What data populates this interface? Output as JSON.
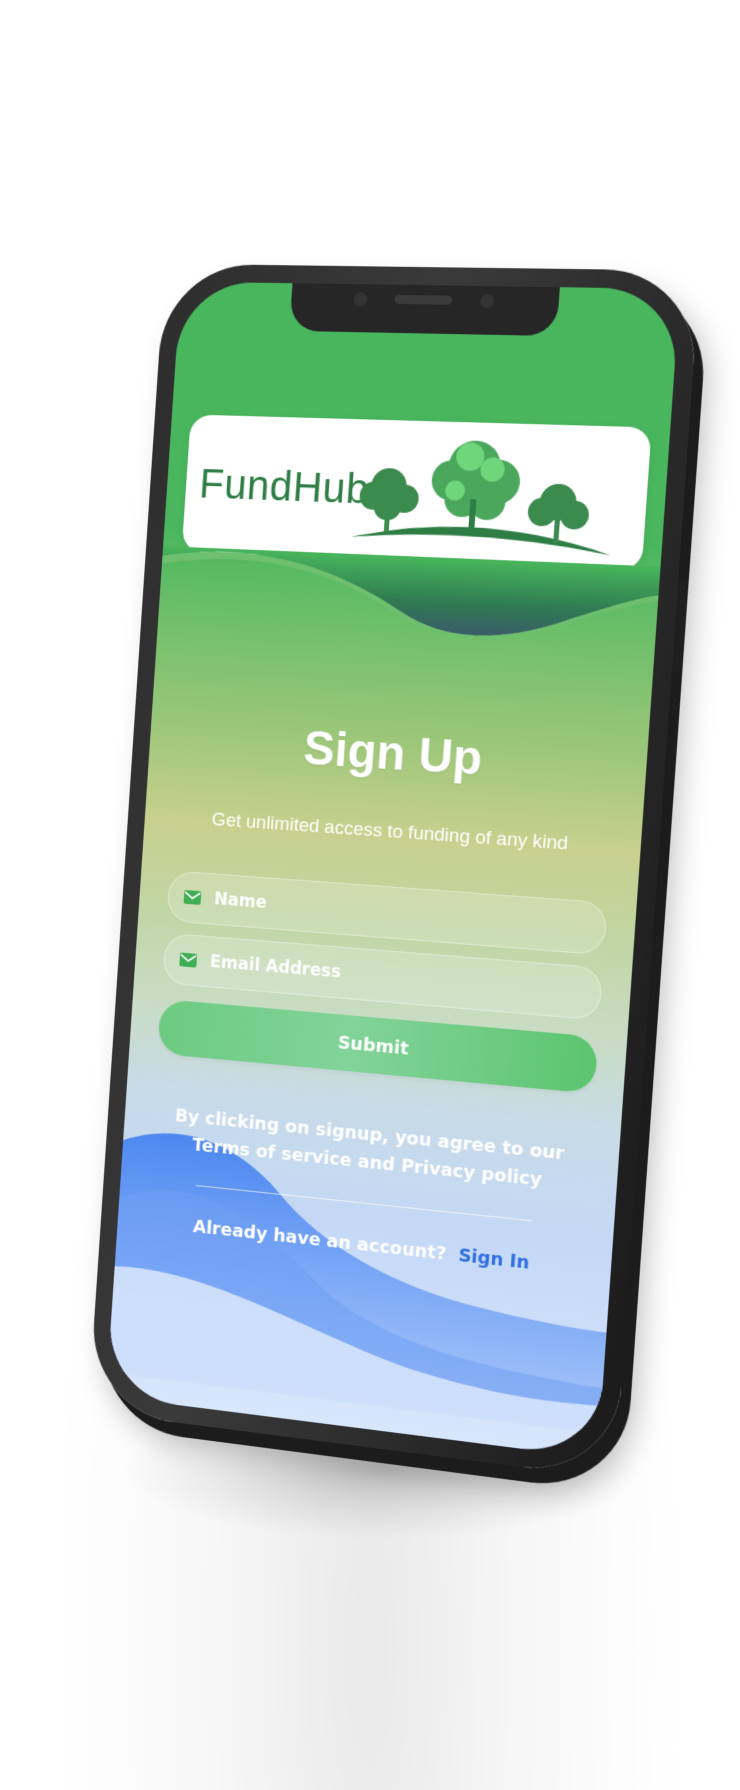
{
  "brand": {
    "name": "FundHub"
  },
  "colors": {
    "primary_green": "#48b65c",
    "accent_blue": "#2f6fe0",
    "wave_blue": "#4a86ee",
    "logo_green": "#2e7d44"
  },
  "signup": {
    "title": "Sign Up",
    "subtitle": "Get unlimited access to funding of any kind",
    "name_field": {
      "placeholder": "Name",
      "value": "",
      "icon": "mail-icon"
    },
    "email_field": {
      "placeholder": "Email Address",
      "value": "",
      "icon": "mail-icon"
    },
    "submit_label": "Submit",
    "terms_text": "By clicking on signup, you agree to our Terms of service and Privacy policy",
    "account_prompt": "Already have an account?",
    "signin_label": "Sign In"
  }
}
